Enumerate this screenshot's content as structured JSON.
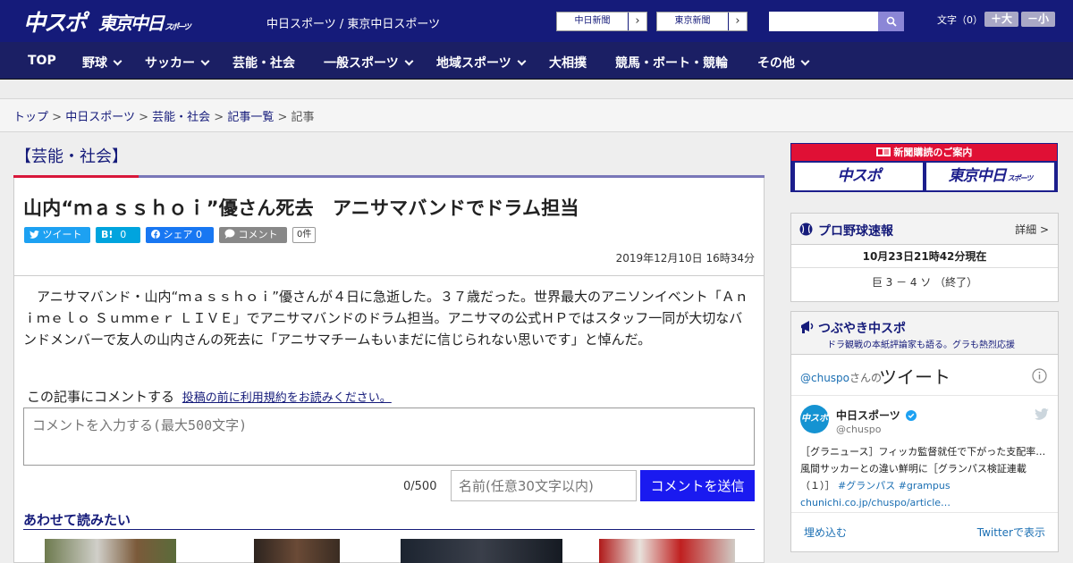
{
  "header": {
    "logo_chuspo": "中スポ",
    "logo_tokyo": "東京中日",
    "logo_tokyo_sub": "スポーツ",
    "site_links": "中日スポーツ / 東京中日スポーツ",
    "pill1_label": "中日新聞",
    "pill2_label": "東京新聞",
    "pill_arrow": "›",
    "fontsize_label": "文字（0）",
    "font_plus": "＋大",
    "font_minus": "－小"
  },
  "nav": {
    "items": [
      {
        "label": "TOP"
      },
      {
        "label": "野球"
      },
      {
        "label": "サッカー"
      },
      {
        "label": "芸能・社会"
      },
      {
        "label": "一般スポーツ"
      },
      {
        "label": "地域スポーツ"
      },
      {
        "label": "大相撲"
      },
      {
        "label": "競馬・ボート・競輪"
      },
      {
        "label": "その他"
      }
    ]
  },
  "breadcrumb": {
    "items": [
      "トップ",
      "中日スポーツ",
      "芸能・社会",
      "記事一覧"
    ],
    "current": "記事",
    "separator": ">"
  },
  "article": {
    "category": "【芸能・社会】",
    "headline": "山内“ｍａｓｓｈｏｉ”優さん死去　アニサマバンドでドラム担当",
    "share": {
      "tweet": "ツイート",
      "hatena": "B!",
      "hatena_count": "0",
      "facebook": "シェア",
      "facebook_count": "0",
      "comment": "コメント",
      "comment_count": "0件"
    },
    "date": "2019年12月10日 16時34分",
    "body": "　アニサマバンド・山内“ｍａｓｓｈｏｉ”優さんが４日に急逝した。３７歳だった。世界最大のアニソンイベント「Ａｎｉｍｅｌｏ Ｓｕｍｍｅｒ ＬＩＶＥ」でアニサマバンドのドラム担当。アニサマの公式ＨＰではスタッフ一同が大切なバンドメンバーで友人の山内さんの死去に「アニサマチームもいまだに信じられない思いです」と悼んだ。"
  },
  "comment_form": {
    "label": "この記事にコメントする",
    "terms_link": "投稿の前に利用規約をお読みください。",
    "placeholder": "コメントを入力する(最大500文字)",
    "counter": "0/500",
    "name_placeholder": "名前(任意30文字以内)",
    "submit": "コメントを送信"
  },
  "related": {
    "title": "あわせて読みたい"
  },
  "sidebar": {
    "ad": {
      "top": "新聞購読のご案内",
      "logo1": "中スポ",
      "logo2": "東京中日",
      "logo2_sub": "スポーツ"
    },
    "baseball": {
      "title": "プロ野球速報",
      "more": "詳細 >",
      "time": "10月23日21時42分現在",
      "score": "巨 3 － 4 ソ （終了）"
    },
    "tweets": {
      "title": "つぶやき中スポ",
      "subtitle": "ドラ観戦の本紙評論家も語る。グラも熱烈応援",
      "handle_link": "@chuspo",
      "handle_suffix": "さんの",
      "heading": "ツイート",
      "account_name": "中日スポーツ",
      "account_handle": "@chuspo",
      "tweet_text": "［グラニュース］フィッカ監督就任で下がった支配率…風間サッカーとの違い鮮明に［グランパス検証連載（１）］",
      "hashtag1": "#グランパス",
      "hashtag2": "#grampus",
      "tweet_url": "chunichi.co.jp/chuspo/article…",
      "embed": "埋め込む",
      "view_on": "Twitterで表示"
    }
  },
  "colors": {
    "header_bg": "#151b7a",
    "nav_bg": "#1b1f64",
    "accent_red": "#d8173a",
    "submit_blue": "#1a1af0",
    "twitter_blue": "#1da1f2"
  }
}
